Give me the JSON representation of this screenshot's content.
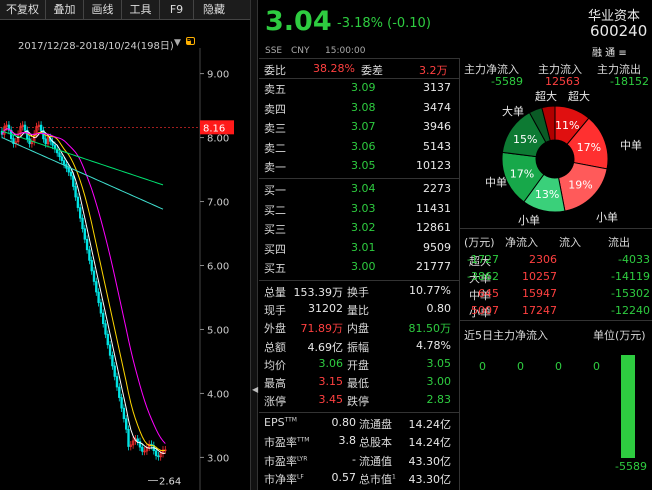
{
  "toolbar": {
    "items": [
      "不复权",
      "叠加",
      "画线",
      "工具",
      "F9",
      "隐藏"
    ]
  },
  "chart": {
    "date_range": "2017/12/28-2018/10/24(198日)",
    "y_ticks": [
      "9.00",
      "8.00",
      "7.00",
      "6.00",
      "5.00",
      "4.00",
      "3.00"
    ],
    "current_price_label": "8.16",
    "low_label": "2.64",
    "ylim": [
      2.6,
      9.4
    ],
    "colors": {
      "up": "#ff3030",
      "down": "#00e5e5",
      "ma5": "#ffffff",
      "ma10": "#ffd700",
      "ma20": "#ff00ff",
      "ma30": "#00e070",
      "ma60": "#40e0d0"
    }
  },
  "quote": {
    "price": "3.04",
    "change": "-3.18% (-0.10)",
    "name": "华业资本",
    "code": "600240",
    "exchange": "SSE",
    "currency": "CNY",
    "time": "15:00:00",
    "icons": "融 通 ≡"
  },
  "book": {
    "weibi_label": "委比",
    "weibi": "38.28%",
    "weicha_label": "委差",
    "weicha": "3.2万",
    "asks": [
      {
        "label": "卖五",
        "price": "3.09",
        "vol": "3137"
      },
      {
        "label": "卖四",
        "price": "3.08",
        "vol": "3474"
      },
      {
        "label": "卖三",
        "price": "3.07",
        "vol": "3946"
      },
      {
        "label": "卖二",
        "price": "3.06",
        "vol": "5143"
      },
      {
        "label": "卖一",
        "price": "3.05",
        "vol": "10123"
      }
    ],
    "bids": [
      {
        "label": "买一",
        "price": "3.04",
        "vol": "2273"
      },
      {
        "label": "买二",
        "price": "3.03",
        "vol": "11431"
      },
      {
        "label": "买三",
        "price": "3.02",
        "vol": "12861"
      },
      {
        "label": "买四",
        "price": "3.01",
        "vol": "9509"
      },
      {
        "label": "买五",
        "price": "3.00",
        "vol": "21777"
      }
    ]
  },
  "stats": [
    {
      "l1": "总量",
      "v1": "153.39万",
      "l2": "换手",
      "v2": "10.77%"
    },
    {
      "l1": "现手",
      "v1": "31202",
      "l2": "量比",
      "v2": "0.80"
    },
    {
      "l1": "外盘",
      "v1": "71.89万",
      "l2": "内盘",
      "v2": "81.50万"
    },
    {
      "l1": "总额",
      "v1": "4.69亿",
      "l2": "振幅",
      "v2": "4.78%"
    },
    {
      "l1": "均价",
      "v1": "3.06",
      "l2": "开盘",
      "v2": "3.05"
    },
    {
      "l1": "最高",
      "v1": "3.15",
      "l2": "最低",
      "v2": "3.00"
    },
    {
      "l1": "涨停",
      "v1": "3.45",
      "l2": "跌停",
      "v2": "2.83"
    }
  ],
  "fin": [
    {
      "l1": "EPS",
      "s1": "TTM",
      "v1": "0.80",
      "l2": "流通盘",
      "v2": "14.24亿"
    },
    {
      "l1": "市盈率",
      "s1": "TTM",
      "v1": "3.8",
      "l2": "总股本",
      "v2": "14.24亿"
    },
    {
      "l1": "市盈率",
      "s1": "LYR",
      "v1": "-",
      "l2": "流通值",
      "v2": "43.30亿"
    },
    {
      "l1": "市净率",
      "s1": "LF",
      "v1": "0.57",
      "l2": "总市值",
      "s2": "1",
      "v2": "43.30亿"
    }
  ],
  "mainflow": {
    "headers": [
      "主力净流入",
      "主力流入",
      "主力流出"
    ],
    "values": [
      "-5589",
      "12563",
      "-18152"
    ],
    "pie_labels": {
      "super_in": "超大",
      "super_out": "超大",
      "big_in": "大单",
      "big_out": "中单",
      "mid_in": "中单",
      "small_in": "小单",
      "small_out": "小单"
    },
    "pie": [
      {
        "name": "超大出",
        "pct": 11,
        "label": "11%",
        "color": "#e01010"
      },
      {
        "name": "中单出",
        "pct": 17,
        "label": "17%",
        "color": "#ff3030"
      },
      {
        "name": "小单出",
        "pct": 19,
        "label": "19%",
        "color": "#ff5a5a"
      },
      {
        "name": "小单入",
        "pct": 13,
        "label": "13%",
        "color": "#3ad07a"
      },
      {
        "name": "中单入",
        "pct": 17,
        "label": "17%",
        "color": "#17a84a"
      },
      {
        "name": "大单入",
        "pct": 15,
        "label": "15%",
        "color": "#0d7a33"
      },
      {
        "name": "超大入",
        "pct": 4,
        "label": "",
        "color": "#0a5a25"
      },
      {
        "name": "大单出",
        "pct": 4,
        "label": "",
        "color": "#b00000"
      }
    ]
  },
  "flow_table": {
    "headers": [
      "(万元)",
      "净流入",
      "流入",
      "流出"
    ],
    "rows": [
      {
        "label": "超大",
        "net": "-1727",
        "in": "2306",
        "out": "-4033"
      },
      {
        "label": "大单",
        "net": "-3862",
        "in": "10257",
        "out": "-14119"
      },
      {
        "label": "中单",
        "net": "645",
        "in": "15947",
        "out": "-15302"
      },
      {
        "label": "小单",
        "net": "5007",
        "in": "17247",
        "out": "-12240"
      }
    ]
  },
  "five_day": {
    "title": "近5日主力净流入",
    "unit": "单位(万元)",
    "values": [
      "0",
      "0",
      "0",
      "0",
      "-5589"
    ],
    "numeric": [
      0,
      0,
      0,
      0,
      -5589
    ]
  }
}
